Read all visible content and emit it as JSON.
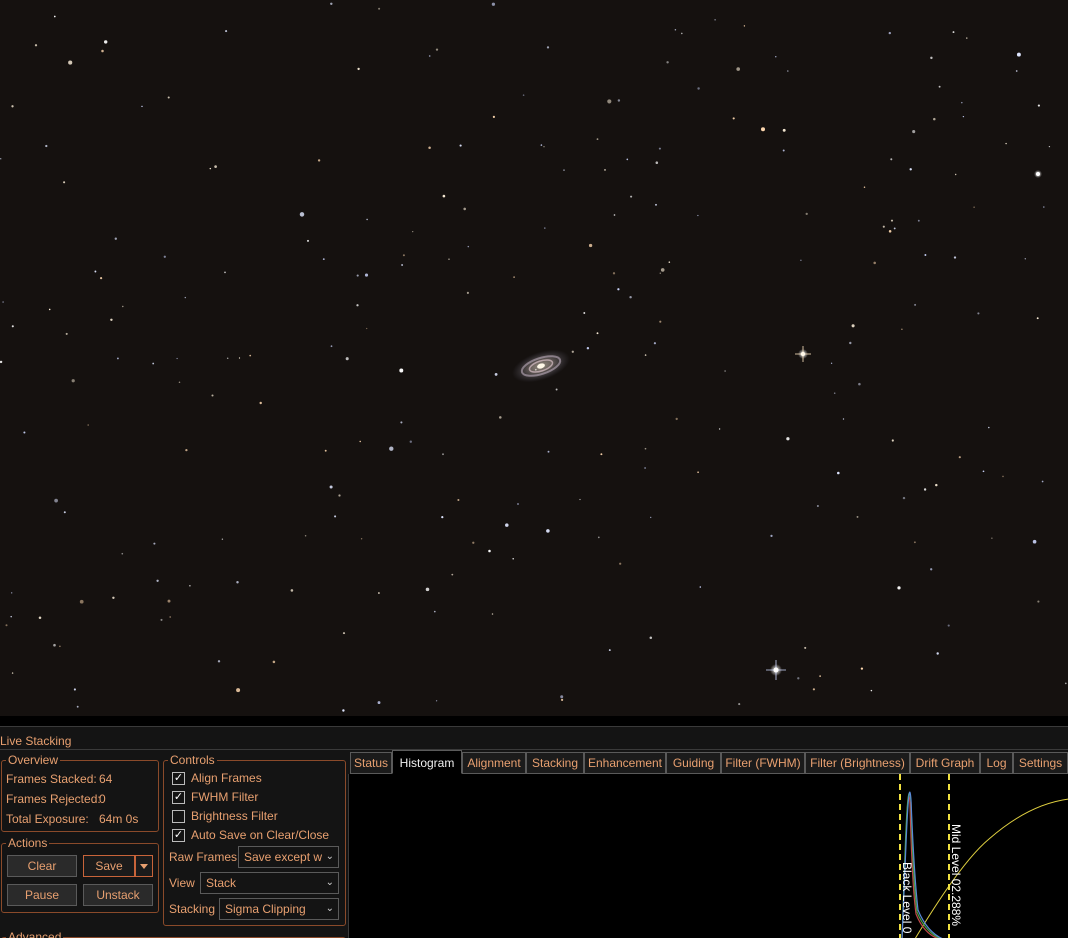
{
  "sky": {
    "galaxy": "spiral-galaxy",
    "stars_hint": "starfield"
  },
  "panel": {
    "title": "Live Stacking",
    "overview": {
      "label": "Overview",
      "frames_stacked_label": "Frames Stacked:",
      "frames_stacked_value": "64",
      "frames_rejected_label": "Frames Rejected:",
      "frames_rejected_value": "0",
      "total_exposure_label": "Total Exposure:",
      "total_exposure_value": "64m 0s"
    },
    "actions": {
      "label": "Actions",
      "clear": "Clear",
      "save": "Save",
      "pause": "Pause",
      "unstack": "Unstack"
    },
    "advanced": {
      "label": "Advanced"
    },
    "controls": {
      "label": "Controls",
      "align_frames": "Align Frames",
      "align_frames_checked": true,
      "fwhm_filter": "FWHM Filter",
      "fwhm_filter_checked": true,
      "brightness_filter": "Brightness Filter",
      "brightness_filter_checked": false,
      "auto_save": "Auto Save on Clear/Close",
      "auto_save_checked": true,
      "raw_frames_label": "Raw Frames",
      "raw_frames_value": "Save except w",
      "view_label": "View",
      "view_value": "Stack",
      "stacking_label": "Stacking",
      "stacking_value": "Sigma Clipping"
    },
    "tabs": [
      "Status",
      "Histogram",
      "Alignment",
      "Stacking",
      "Enhancement",
      "Guiding",
      "Filter (FWHM)",
      "Filter (Brightness)",
      "Drift Graph",
      "Log",
      "Settings"
    ],
    "active_tab": "Histogram",
    "histogram": {
      "black_level_label": "Black Level 0",
      "mid_level_label": "Mid Level 02.288%"
    }
  },
  "colors": {
    "accent": "#e8a070",
    "group_border": "#8a4a2a",
    "level_line": "#f0e040",
    "curve": "#e0d040"
  }
}
